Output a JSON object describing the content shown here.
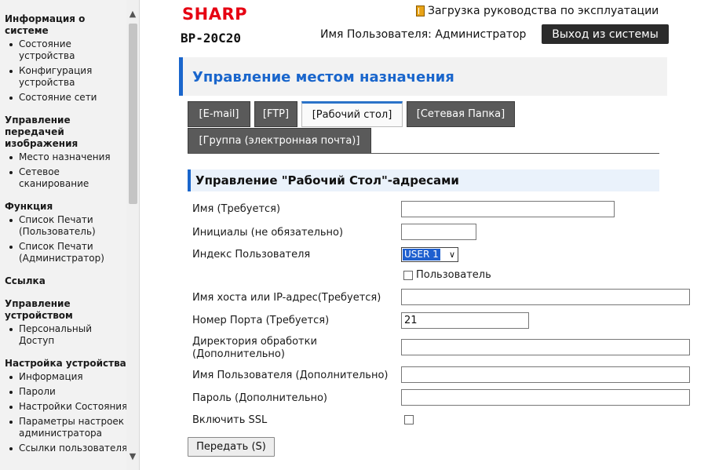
{
  "sidebar": {
    "groups": [
      {
        "heading": "Информация о системе",
        "items": [
          "Состояние устройства",
          "Конфигурация устройства",
          "Состояние сети"
        ]
      },
      {
        "heading": "Управление передачей изображения",
        "items": [
          "Место назначения",
          "Сетевое сканирование"
        ]
      },
      {
        "heading": "Функция",
        "items": [
          "Список Печати (Пользователь)",
          "Список Печати (Администратор)"
        ]
      },
      {
        "heading": "Ссылка",
        "items": []
      },
      {
        "heading": "Управление устройством",
        "items": [
          "Персональный Доступ"
        ]
      },
      {
        "heading": "Настройка устройства",
        "items": [
          "Информация",
          "Пароли",
          "Настройки Состояния",
          "Параметры настроек администратора",
          "Ссылки пользователя"
        ]
      }
    ]
  },
  "header": {
    "logo": "SHARP",
    "model": "BP-20C20",
    "manual_link": "Загрузка руководства по эксплуатации",
    "user_label": "Имя Пользователя: Администратор",
    "logout": "Выход из системы"
  },
  "page": {
    "title": "Управление местом назначения"
  },
  "tabs": [
    {
      "label": "[E-mail]",
      "active": false
    },
    {
      "label": "[FTP]",
      "active": false
    },
    {
      "label": "[Рабочий стол]",
      "active": true
    },
    {
      "label": "[Сетевая Папка]",
      "active": false
    },
    {
      "label": "[Группа (электронная почта)]",
      "active": false
    }
  ],
  "form": {
    "section_title": "Управление \"Рабочий Стол\"-адресами",
    "name_label": "Имя (Требуется)",
    "name_value": "",
    "initials_label": "Инициалы (не обязательно)",
    "initials_value": "",
    "user_index_label": "Индекс Пользователя",
    "user_index_value": "USER 1",
    "user_checkbox_label": "Пользователь",
    "host_label": "Имя хоста или IP-адрес(Требуется)",
    "host_value": "",
    "port_label": "Номер Порта (Требуется)",
    "port_value": "21",
    "dir_label_line1": "Директория обработки",
    "dir_label_line2": "(Дополнительно)",
    "dir_value": "",
    "username_label": "Имя Пользователя (Дополнительно)",
    "username_value": "",
    "password_label": "Пароль (Дополнительно)",
    "password_value": "",
    "ssl_label": "Включить SSL",
    "submit": "Передать (S)"
  }
}
